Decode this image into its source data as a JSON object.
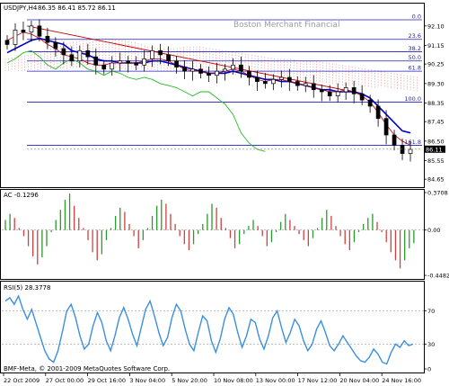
{
  "watermark": "Boston Merchant Financial",
  "copyright": "BMF-Meta, © 2001-2009 MetaQuotes Software Corp.",
  "colors": {
    "candle": "#000000",
    "kumo": "#e8a0a0",
    "trend": "#c00000",
    "blue_line": "#0000cc",
    "chikou": "#22bb22",
    "fib": "#1f1fbf",
    "ac_up": "#2a9a2a",
    "ac_down": "#d04040",
    "rsi": "#3a8fe0",
    "hline": "#808080"
  },
  "chart_data": [
    {
      "type": "candlestick",
      "title": "USDJPY,H4",
      "ohlc_label": "86.35 86.41 85.72 86.11",
      "ylim": [
        84.35,
        92.75
      ],
      "yticks": [
        "92.10",
        "91.15",
        "90.25",
        "89.30",
        "88.35",
        "87.45",
        "86.50",
        "85.55",
        "84.65"
      ],
      "last_price": "86.11",
      "close": [
        91.2,
        91.9,
        91.8,
        92.1,
        91.6,
        91.3,
        91.0,
        90.7,
        90.4,
        90.9,
        90.6,
        90.2,
        90.0,
        90.3,
        90.4,
        90.3,
        90.2,
        90.5,
        90.9,
        90.7,
        90.4,
        90.1,
        89.9,
        90.0,
        89.8,
        89.7,
        89.9,
        90.0,
        90.2,
        89.9,
        89.6,
        89.4,
        89.3,
        89.5,
        89.6,
        89.4,
        89.2,
        89.3,
        89.0,
        88.9,
        88.7,
        88.9,
        89.1,
        88.8,
        88.5,
        88.2,
        87.6,
        86.8,
        86.3,
        85.9,
        86.1
      ],
      "tenkan": [
        91.4,
        91.6,
        91.8,
        91.7,
        91.5,
        91.2,
        91.0,
        90.7,
        90.6,
        90.5,
        90.3,
        90.2,
        90.2,
        90.3,
        90.3,
        90.3,
        90.3,
        90.4,
        90.5,
        90.5,
        90.4,
        90.2,
        90.0,
        89.9,
        89.9,
        89.8,
        89.8,
        89.9,
        90.0,
        89.9,
        89.7,
        89.5,
        89.4,
        89.5,
        89.5,
        89.4,
        89.3,
        89.2,
        89.1,
        89.0,
        88.9,
        88.9,
        89.0,
        88.9,
        88.7,
        88.4,
        87.9,
        87.3,
        86.8,
        86.5,
        86.3
      ],
      "kijun": [
        90.8,
        91.0,
        91.2,
        91.4,
        91.5,
        91.4,
        91.3,
        91.2,
        90.9,
        90.8,
        90.7,
        90.5,
        90.4,
        90.4,
        90.3,
        90.3,
        90.3,
        90.3,
        90.4,
        90.4,
        90.3,
        90.2,
        90.1,
        90.0,
        89.9,
        89.8,
        89.8,
        89.8,
        89.9,
        89.8,
        89.7,
        89.6,
        89.5,
        89.5,
        89.4,
        89.4,
        89.3,
        89.2,
        89.1,
        89.0,
        89.0,
        88.9,
        88.9,
        88.9,
        88.8,
        88.6,
        88.2,
        87.8,
        87.4,
        87.0,
        86.9
      ],
      "chikou": [
        90.3,
        90.5,
        90.8,
        90.9,
        90.6,
        90.2,
        90.0,
        90.3,
        90.5,
        90.3,
        90.0,
        89.9,
        89.7,
        89.9,
        89.8,
        89.6,
        89.5,
        89.6,
        89.5,
        89.3,
        89.2,
        89.1,
        88.9,
        88.7,
        88.9,
        88.9,
        88.6,
        88.3,
        87.8,
        86.9,
        86.4,
        86.1,
        86.0
      ],
      "kumo_top": [
        90.5,
        90.6,
        90.7,
        90.9,
        91.1,
        91.3,
        91.4,
        91.5,
        91.5,
        91.4,
        91.3,
        91.1,
        91.0,
        91.0,
        91.1,
        91.1,
        91.0,
        90.9,
        90.8,
        90.7,
        90.6,
        90.5,
        90.5,
        90.4,
        90.4,
        90.3,
        90.2,
        90.1,
        90.0,
        89.9,
        89.8,
        89.7,
        89.6
      ],
      "kumo_bottom": [
        89.9,
        89.9,
        89.9,
        90.0,
        90.0,
        90.0,
        90.1,
        90.1,
        90.1,
        90.0,
        90.0,
        90.0,
        89.9,
        89.9,
        89.9,
        89.8,
        89.8,
        89.7,
        89.7,
        89.6,
        89.6,
        89.5,
        89.5,
        89.4,
        89.4,
        89.3,
        89.2,
        89.2,
        89.1,
        89.1,
        89.0,
        89.0,
        88.9
      ],
      "trendline": [
        [
          92.1,
          0.06
        ],
        [
          88.8,
          0.86
        ]
      ],
      "fibonacci": [
        {
          "label": "0.0",
          "value": 92.4
        },
        {
          "label": "23.6",
          "value": 91.45
        },
        {
          "label": "38.2",
          "value": 90.85
        },
        {
          "label": "50.0",
          "value": 90.4
        },
        {
          "label": "61.8",
          "value": 89.9
        },
        {
          "label": "100.0",
          "value": 88.4
        },
        {
          "label": "161.8",
          "value": 86.3
        }
      ]
    },
    {
      "type": "bar",
      "title": "AC -0.1296",
      "ylim": [
        -0.4482,
        0.3708
      ],
      "yticks": [
        "0.3708",
        "0.00",
        "-0.4482"
      ],
      "values": [
        0.1,
        0.16,
        0.12,
        0.02,
        -0.06,
        -0.16,
        -0.26,
        -0.34,
        -0.27,
        -0.16,
        -0.02,
        0.1,
        0.2,
        0.3,
        0.36,
        0.24,
        0.12,
        0.02,
        -0.1,
        -0.22,
        -0.3,
        -0.24,
        -0.1,
        0.02,
        0.14,
        0.22,
        0.18,
        0.06,
        -0.06,
        -0.18,
        -0.1,
        0.02,
        0.14,
        0.24,
        0.3,
        0.26,
        0.16,
        0.06,
        -0.06,
        -0.14,
        -0.2,
        -0.14,
        -0.04,
        0.06,
        0.16,
        0.26,
        0.22,
        0.12,
        0.02,
        -0.08,
        -0.18,
        -0.14,
        -0.04,
        0.04,
        0.1,
        0.04,
        -0.06,
        -0.16,
        -0.12,
        -0.02,
        0.08,
        0.16,
        0.1,
        0.04,
        -0.04,
        -0.1,
        -0.16,
        -0.08,
        0.02,
        0.12,
        0.2,
        0.14,
        0.04,
        -0.06,
        -0.14,
        -0.2,
        -0.12,
        -0.02,
        0.06,
        0.12,
        0.16,
        0.08,
        -0.02,
        -0.12,
        -0.22,
        -0.3,
        -0.38,
        -0.3,
        -0.18,
        -0.13
      ]
    },
    {
      "type": "line",
      "title": "RSI(5) 28.3778",
      "ylim": [
        0,
        100
      ],
      "yticks": [
        "70",
        "30",
        "0"
      ],
      "levels": [
        70,
        30
      ],
      "values": [
        82,
        86,
        78,
        88,
        72,
        60,
        72,
        55,
        38,
        22,
        12,
        8,
        22,
        45,
        70,
        78,
        62,
        40,
        24,
        30,
        52,
        68,
        56,
        34,
        22,
        40,
        62,
        74,
        60,
        42,
        28,
        50,
        72,
        82,
        64,
        44,
        28,
        38,
        62,
        78,
        70,
        48,
        30,
        22,
        44,
        64,
        58,
        34,
        20,
        36,
        60,
        74,
        66,
        44,
        26,
        40,
        60,
        56,
        36,
        24,
        40,
        62,
        70,
        50,
        32,
        44,
        60,
        52,
        34,
        22,
        30,
        48,
        58,
        44,
        28,
        22,
        30,
        40,
        32,
        24,
        16,
        10,
        8,
        14,
        24,
        18,
        8,
        6,
        20,
        30,
        26,
        34,
        28,
        30
      ]
    }
  ],
  "x_axis": {
    "labels": [
      "22 Oct 2009",
      "27 Oct 00:00",
      "29 Oct 16:00",
      "3 Nov 04:00",
      "5 Nov 20:00",
      "10 Nov 08:00",
      "13 Nov 00:00",
      "17 Nov 12:00",
      "20 Nov 04:00",
      "24 Nov 16:00"
    ]
  }
}
